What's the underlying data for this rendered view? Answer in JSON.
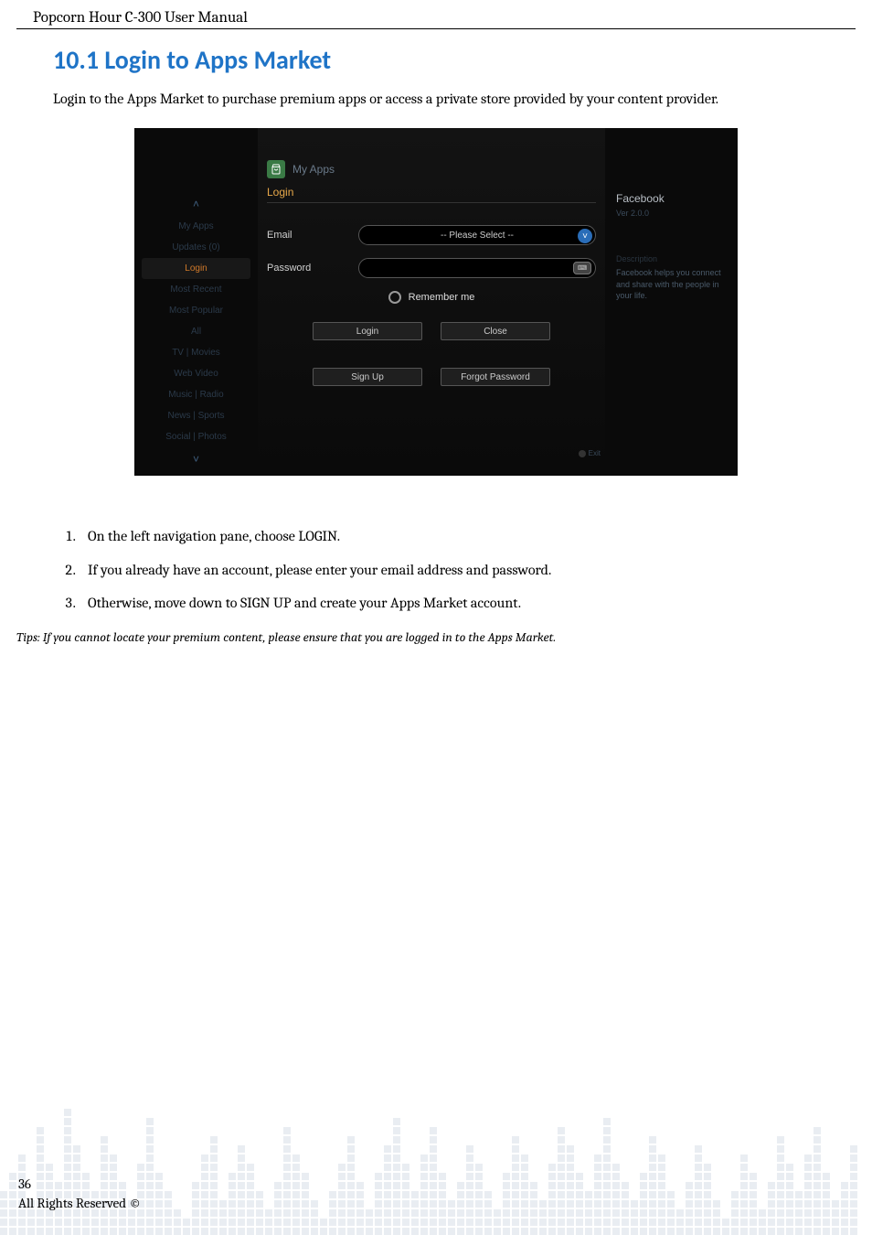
{
  "header": {
    "title": "Popcorn Hour C-300 User Manual"
  },
  "section": {
    "number": "10.1",
    "title": "Login to Apps Market",
    "intro": "Login to the Apps Market to purchase premium apps or access a private store provided by your content provider."
  },
  "screenshot": {
    "tab": "My Apps",
    "login_title": "Login",
    "sidebar": {
      "items": [
        {
          "label": "˄",
          "cls": "chev"
        },
        {
          "label": "My Apps",
          "cls": ""
        },
        {
          "label": "Updates (0)",
          "cls": ""
        },
        {
          "label": "Login",
          "cls": "highlight"
        },
        {
          "label": "Most Recent",
          "cls": ""
        },
        {
          "label": "Most Popular",
          "cls": ""
        },
        {
          "label": "All",
          "cls": ""
        },
        {
          "label": "TV | Movies",
          "cls": ""
        },
        {
          "label": "Web Video",
          "cls": ""
        },
        {
          "label": "Music | Radio",
          "cls": ""
        },
        {
          "label": "News | Sports",
          "cls": ""
        },
        {
          "label": "Social | Photos",
          "cls": ""
        },
        {
          "label": "˅",
          "cls": "chev"
        }
      ]
    },
    "form": {
      "email_label": "Email",
      "email_placeholder": "-- Please Select --",
      "password_label": "Password",
      "remember": "Remember me",
      "login_btn": "Login",
      "close_btn": "Close",
      "signup_btn": "Sign Up",
      "forgot_btn": "Forgot Password"
    },
    "info": {
      "app": "Facebook",
      "ver": "Ver 2.0.0",
      "desc_label": "Description",
      "desc": "Facebook helps you connect and share with the people in your life."
    },
    "exit": "Exit"
  },
  "steps": [
    "On the left navigation pane, choose LOGIN.",
    "If you already have an account, please enter your email address and password.",
    "Otherwise, move down to SIGN UP and create your Apps Market account."
  ],
  "tips": "Tips: If you cannot locate your premium content, please ensure that you are logged in to the Apps Market.",
  "footer": {
    "page": "36",
    "rights": "All Rights Reserved ©"
  }
}
